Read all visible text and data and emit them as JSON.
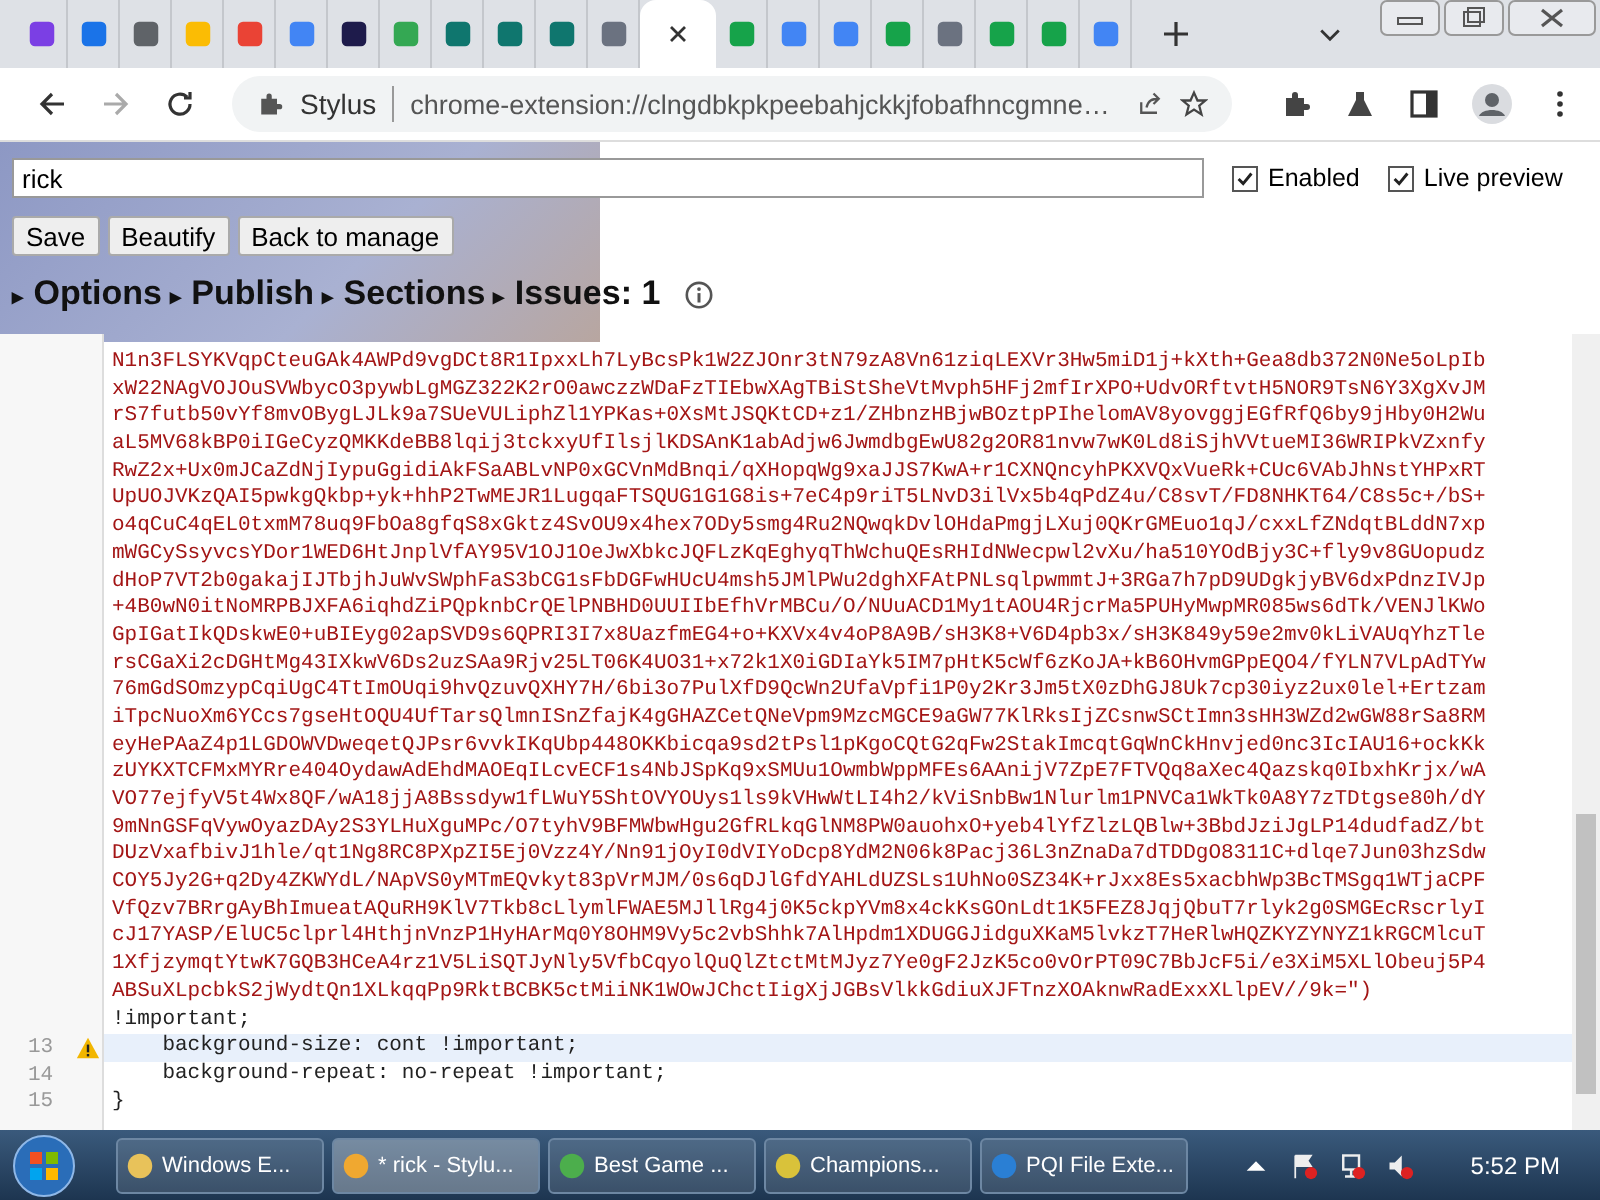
{
  "browser": {
    "tabs": [
      {
        "selected": false
      },
      {
        "selected": false
      },
      {
        "selected": false
      },
      {
        "selected": false
      },
      {
        "selected": false
      },
      {
        "selected": false
      },
      {
        "selected": false
      },
      {
        "selected": false
      },
      {
        "selected": false
      },
      {
        "selected": false
      },
      {
        "selected": false
      },
      {
        "selected": false
      },
      {
        "selected": true
      },
      {
        "selected": false
      },
      {
        "selected": false
      },
      {
        "selected": false
      },
      {
        "selected": false
      },
      {
        "selected": false
      },
      {
        "selected": false
      },
      {
        "selected": false
      },
      {
        "selected": false
      }
    ],
    "forward_disabled": true,
    "site_label": "Stylus",
    "url": "chrome-extension://clngdbkpkpeebahjckkjfobafhncgmne…"
  },
  "editor": {
    "name": "rick",
    "enabled": true,
    "live_preview": true,
    "enabled_label": "Enabled",
    "live_preview_label": "Live preview",
    "buttons": [
      "Save",
      "Beautify",
      "Back to manage"
    ],
    "sections": [
      {
        "marker": "▸",
        "label": "Options"
      },
      {
        "marker": "▸",
        "label": "Publish"
      },
      {
        "marker": "▸",
        "label": "Sections"
      },
      {
        "marker": "▸",
        "label": "Issues: 1"
      }
    ],
    "code_lines": [
      {
        "text": "N1n3FLSYKVqpCteuGAk4AWPd9vgDCt8R1IpxxLh7LyBcsPk1W2ZJOnr3tN79zA8Vn61ziqLEXVr3Hw5miD1j+kXth+Gea8db372N0Ne5oLpIb",
        "kind": "string",
        "warning": false,
        "current": false
      },
      {
        "text": "xW22NAgVOJOuSVWbycO3pywbLgMGZ322K2rO0awczzWDaFzTIEbwXAgTBiStSheVtMvph5HFj2mfIrXPO+UdvORftvtH5NOR9TsN6Y3XgXvJM",
        "kind": "string",
        "warning": false,
        "current": false
      },
      {
        "text": "rS7futb50vYf8mvOBygLJLk9a7SUeVULiphZl1YPKas+0XsMtJSQKtCD+z1/ZHbnzHBjwBOztpPIhelomAV8yovggjEGfRfQ6by9jHby0H2Wu",
        "kind": "string",
        "warning": false,
        "current": false
      },
      {
        "text": "aL5MV68kBP0iIGeCyzQMKKdeBB8lqij3tckxyUfIlsjlKDSAnK1abAdjw6JwmdbgEwU82g2OR81nvw7wK0Ld8iSjhVVtueMI36WRIPkVZxnfy",
        "kind": "string",
        "warning": false,
        "current": false
      },
      {
        "text": "RwZ2x+Ux0mJCaZdNjIypuGgidiAkFSaABLvNP0xGCVnMdBnqi/qXHopqWg9xaJJS7KwA+r1CXNQncyhPKXVQxVueRk+CUc6VAbJhNstYHPxRT",
        "kind": "string",
        "warning": false,
        "current": false
      },
      {
        "text": "UpUOJVKzQAI5pwkgQkbp+yk+hhP2TwMEJR1LugqaFTSQUG1G1G8is+7eC4p9riT5LNvD3ilVx5b4qPdZ4u/C8svT/FD8NHKT64/C8s5c+/bS+",
        "kind": "string",
        "warning": false,
        "current": false
      },
      {
        "text": "o4qCuC4qEL0txmM78uq9FbOa8gfqS8xGktz4SvOU9x4hex7ODy5smg4Ru2NQwqkDvlOHdaPmgjLXuj0QKrGMEuo1qJ/cxxLfZNdqtBLddN7xp",
        "kind": "string",
        "warning": false,
        "current": false
      },
      {
        "text": "mWGCySsyvcsYDor1WED6HtJnplVfAY95V1OJ1OeJwXbkcJQFLzKqEghyqThWchuQEsRHIdNWecpwl2vXu/ha510YOdBjy3C+fly9v8GUopudz",
        "kind": "string",
        "warning": false,
        "current": false
      },
      {
        "text": "dHoP7VT2b0gakajIJTbjhJuWvSWphFaS3bCG1sFbDGFwHUcU4msh5JMlPWu2dghXFAtPNLsqlpwmmtJ+3RGa7h7pD9UDgkjyBV6dxPdnzIVJp",
        "kind": "string",
        "warning": false,
        "current": false
      },
      {
        "text": "+4B0wN0itNoMRPBJXFA6iqhdZiPQpknbCrQElPNBHD0UUIIbEfhVrMBCu/O/NUuACD1My1tAOU4RjcrMa5PUHyMwpMR085ws6dTk/VENJlKWo",
        "kind": "string",
        "warning": false,
        "current": false
      },
      {
        "text": "GpIGatIkQDskwE0+uBIEyg02apSVD9s6QPRI3I7x8UazfmEG4+o+KXVx4v4oP8A9B/sH3K8+V6D4pb3x/sH3K849y59e2mv0kLiVAUqYhzTle",
        "kind": "string",
        "warning": false,
        "current": false
      },
      {
        "text": "rsCGaXi2cDGHtMg43IXkwV6Ds2uzSAa9Rjv25LT06K4UO31+x72k1X0iGDIaYk5IM7pHtK5cWf6zKoJA+kB6OHvmGPpEQO4/fYLN7VLpAdTYw",
        "kind": "string",
        "warning": false,
        "current": false
      },
      {
        "text": "76mGdSOmzypCqiUgC4TtImOUqi9hvQzuvQXHY7H/6bi3o7PulXfD9QcWn2UfaVpfi1P0y2Kr3Jm5tX0zDhGJ8Uk7cp30iyz2ux0lel+Ertzam",
        "kind": "string",
        "warning": false,
        "current": false
      },
      {
        "text": "iTpcNuoXm6YCcs7gseHtOQU4UfTarsQlmnISnZfajK4gGHAZCetQNeVpm9MzcMGCE9aGW77KlRksIjZCsnwSCtImn3sHH3WZd2wGW88rSa8RM",
        "kind": "string",
        "warning": false,
        "current": false
      },
      {
        "text": "eyHePAaZ4p1LGDOWVDweqetQJPsr6vvkIKqUbp448OKKbicqa9sd2tPsl1pKgoCQtG2qFw2StakImcqtGqWnCkHnvjed0nc3IcIAU16+ockKk",
        "kind": "string",
        "warning": false,
        "current": false
      },
      {
        "text": "zUYKXTCFMxMYRre404OydawAdEhdMAOEqILcvECF1s4NbJSpKq9xSMUu1OwmbWppMFEs6AAnijV7ZpE7FTVQq8aXec4Qazskq0IbxhKrjx/wA",
        "kind": "string",
        "warning": false,
        "current": false
      },
      {
        "text": "VO77ejfyV5t4Wx8QF/wA18jjA8Bssdyw1fLWuY5ShtOVYOUys1ls9kVHwWtLI4h2/kViSnbBw1Nlurlm1PNVCa1WkTk0A8Y7zTDtgse80h/dY",
        "kind": "string",
        "warning": false,
        "current": false
      },
      {
        "text": "9mNnGSFqVywOyazDAy2S3YLHuXguMPc/O7tyhV9BFMWbwHgu2GfRLkqGlNM8PW0auohxO+yeb4lYfZlzLQBlw+3BbdJziJgLP14dudfadZ/bt",
        "kind": "string",
        "warning": false,
        "current": false
      },
      {
        "text": "DUzVxafbivJ1hle/qt1Ng8RC8PXpZI5Ej0Vzz4Y/Nn91jOyI0dVIYoDcp8YdM2N06k8Pacj36L3nZnaDa7dTDDgO8311C+dlqe7Jun03hzSdw",
        "kind": "string",
        "warning": false,
        "current": false
      },
      {
        "text": "COY5Jy2G+q2Dy4ZKWYdL/NApVS0yMTmEQvkyt83pVrMJM/0s6qDJlGfdYAHLdUZSLs1UhNo0SZ34K+rJxx8Es5xacbhWp3BcTMSgq1WTjaCPF",
        "kind": "string",
        "warning": false,
        "current": false
      },
      {
        "text": "VfQzv7BRrgAyBhImueatAQuRH9KlV7Tkb8cLlymlFWAE5MJllRg4j0K5ckpYVm8x4ckKsGOnLdt1K5FEZ8JqjQbuT7rlyk2g0SMGEcRscrlyI",
        "kind": "string",
        "warning": false,
        "current": false
      },
      {
        "text": "cJ17YASP/ElUC5clprl4HthjnVnzP1HyHArMq0Y8OHM9Vy5c2vbShhk7AlHpdm1XDUGGJidguXKaM5lvkzT7HeRlwHQZKYZYNYZ1kRGCMlcuT",
        "kind": "string",
        "warning": false,
        "current": false
      },
      {
        "text": "1XfjzymqtYtwK7GQB3HCeA4rz1V5LiSQTJyNly5VfbCqyolQuQlZtctMtMJyz7Ye0gF2JzK5co0vOrPT09C7BbJcF5i/e3XiM5XLlObeuj5P4",
        "kind": "string",
        "warning": false,
        "current": false
      },
      {
        "text": "ABSuXLpcbkS2jWydtQn1XLkqqPp9RktBCBK5ctMiiNK1WOwJChctIigXjJGBsVlkkGdiuXJFTnzXOAknwRadExxXLlpEV//9k=\")",
        "kind": "string",
        "warning": false,
        "current": false
      },
      {
        "text": "!important;",
        "kind": "code",
        "warning": false,
        "current": false
      },
      {
        "number": "13",
        "text": "    background-size: cont !important;",
        "kind": "code",
        "warning": true,
        "current": true
      },
      {
        "number": "14",
        "text": "    background-repeat: no-repeat !important;",
        "kind": "code",
        "warning": false,
        "current": false
      },
      {
        "number": "15",
        "text": "}",
        "kind": "code",
        "warning": false,
        "current": false
      }
    ]
  },
  "taskbar": {
    "items": [
      {
        "label": "Windows E...",
        "selected": false
      },
      {
        "label": "* rick - Stylu...",
        "selected": true
      },
      {
        "label": "Best Game ...",
        "selected": false
      },
      {
        "label": "Champions...",
        "selected": false
      },
      {
        "label": "PQI File Exte...",
        "selected": false
      }
    ],
    "clock": "5:52 PM"
  }
}
